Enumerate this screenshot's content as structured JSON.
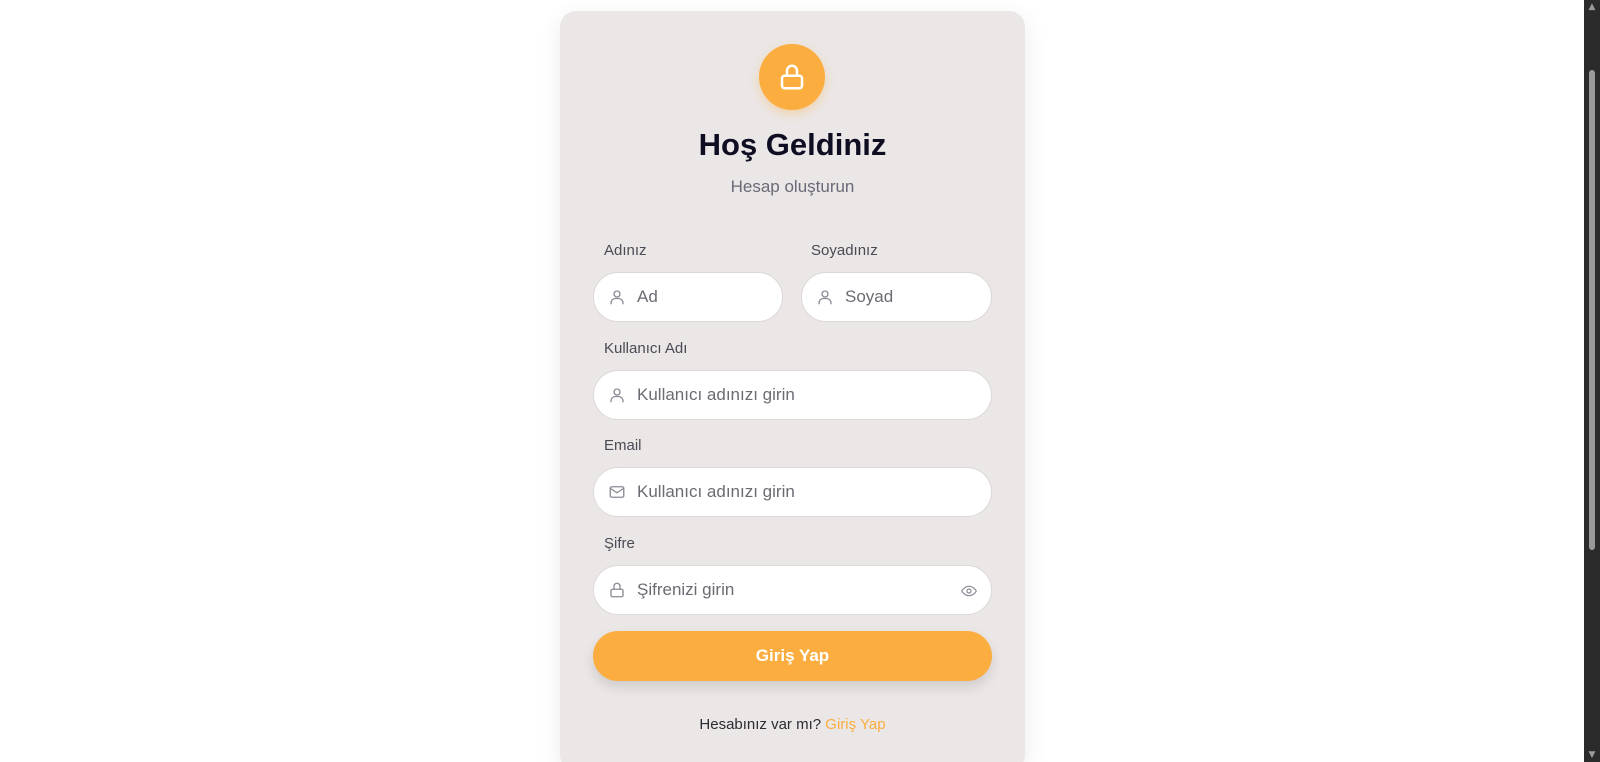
{
  "header": {
    "title": "Hoş Geldiniz",
    "subtitle": "Hesap oluşturun",
    "badge_icon": "lock-icon"
  },
  "form": {
    "first_name": {
      "label": "Adınız",
      "placeholder": "Ad",
      "icon": "user-icon"
    },
    "last_name": {
      "label": "Soyadınız",
      "placeholder": "Soyad",
      "icon": "user-icon"
    },
    "username": {
      "label": "Kullanıcı Adı",
      "placeholder": "Kullanıcı adınızı girin",
      "icon": "user-icon"
    },
    "email": {
      "label": "Email",
      "placeholder": "Kullanıcı adınızı girin",
      "icon": "mail-icon"
    },
    "password": {
      "label": "Şifre",
      "placeholder": "Şifrenizi girin",
      "icon": "lock-icon",
      "toggle_icon": "eye-icon"
    },
    "submit_label": "Giriş Yap"
  },
  "footer": {
    "prompt": "Hesabınız var mı?",
    "link_label": "Giriş Yap"
  },
  "colors": {
    "accent": "#fcad3f",
    "card_bg": "#ebe7e6",
    "title": "#0e0d22",
    "muted": "#6a6a78"
  }
}
